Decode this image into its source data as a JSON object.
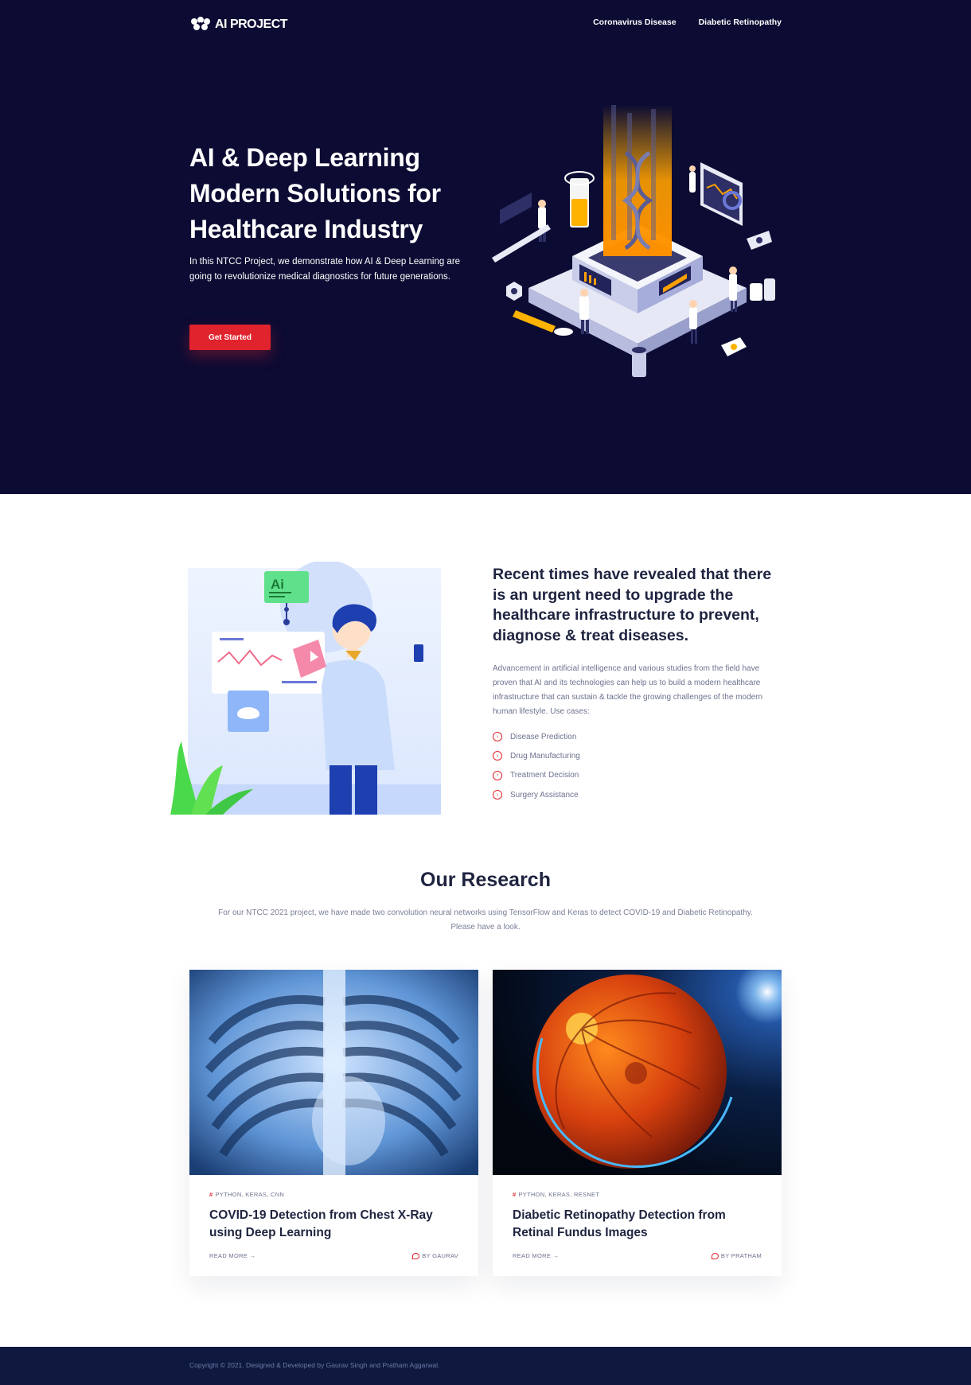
{
  "nav": {
    "logo": "AI PROJECT",
    "links": [
      "Coronavirus Disease",
      "Diabetic Retinopathy"
    ]
  },
  "hero": {
    "title_line1": "AI & Deep Learning",
    "title_line2": "Modern Solutions for",
    "title_line3": "Healthcare Industry",
    "subtitle": "In this NTCC Project, we demonstrate how AI & Deep Learning are going to revolutionize medical diagnostics for future generations.",
    "cta": "Get Started",
    "illustration_icon": "isometric-dna-lab-illustration"
  },
  "about": {
    "illustration_badge": "Ai",
    "heading": "Recent times have revealed that there is an urgent need to upgrade the healthcare infrastructure to prevent, diagnose & treat diseases.",
    "text": "Advancement in artificial intelligence and various studies from the field have proven that AI and its technologies can help us to build a modern healthcare infrastructure that can sustain & tackle the growing challenges of the modern human lifestyle. Use cases:",
    "use_cases": [
      "Disease Prediction",
      "Drug Manufacturing",
      "Treatment Decision",
      "Surgery Assistance"
    ]
  },
  "research": {
    "title": "Our Research",
    "subtitle": "For our NTCC 2021 project, we have made two convolution neural networks using TensorFlow and Keras to detect COVID-19 and Diabetic Retinopathy. Please have a look.",
    "cards": [
      {
        "tags": "PYTHON, KERAS, CNN",
        "title": "COVID-19 Detection from Chest X-Ray using Deep Learning",
        "read_more": "READ MORE →",
        "author": "BY GAURAV",
        "image_icon": "chest-xray-image"
      },
      {
        "tags": "PYTHON, KERAS, RESNET",
        "title": "Diabetic Retinopathy Detection from Retinal Fundus Images",
        "read_more": "READ MORE →",
        "author": "BY PRATHAM",
        "image_icon": "retina-fundus-image"
      }
    ]
  },
  "footer": {
    "text": "Copyright © 2021. Designed & Developed by Gaurav Singh and Pratham Aggarwal."
  },
  "colors": {
    "hero_bg": "#0c0b33",
    "accent_red": "#e0232c",
    "heading_dark": "#1f2440",
    "footer_bg": "#0f1940"
  }
}
